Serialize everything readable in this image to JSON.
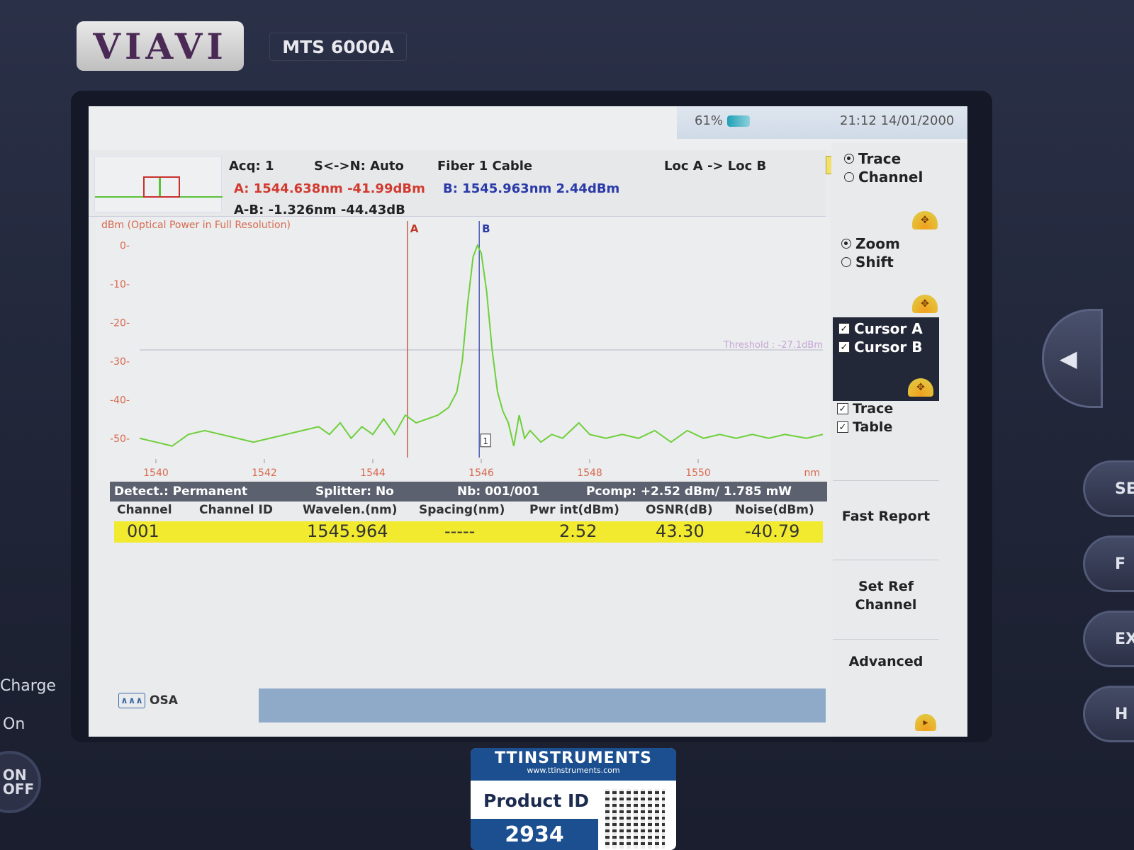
{
  "device": {
    "brand": "VIAVI",
    "model": "MTS 6000A"
  },
  "status": {
    "battery": "61%",
    "time": "21:12",
    "date": "14/01/2000"
  },
  "info": {
    "acq": "Acq: 1",
    "sn": "S<->N: Auto",
    "fiber": "Fiber  1  Cable",
    "loc": "Loc A -> Loc B",
    "cursor_a": "A: 1544.638nm -41.99dBm",
    "cursor_b": "B: 1545.963nm  2.44dBm",
    "delta": "A-B: -1.326nm -44.43dB",
    "trace_number": "1"
  },
  "right_panel": {
    "mode1_trace": "Trace",
    "mode1_channel": "Channel",
    "mode2_zoom": "Zoom",
    "mode2_shift": "Shift",
    "cursor_a": "Cursor A",
    "cursor_b": "Cursor B",
    "show_trace": "Trace",
    "show_table": "Table",
    "fast_report": "Fast Report",
    "set_ref_channel": "Set Ref Channel",
    "advanced": "Advanced"
  },
  "chart_data": {
    "type": "line",
    "ylabel": "dBm  (Optical Power in Full Resolution)",
    "xlabel": "nm",
    "xlim": [
      1539.7,
      1552.3
    ],
    "ylim": [
      -55,
      3
    ],
    "x_ticks": [
      1540,
      1542,
      1544,
      1546,
      1548,
      1550
    ],
    "y_ticks": [
      0,
      -10,
      -20,
      -30,
      -40,
      -50
    ],
    "threshold": {
      "label": "Threshold : -27.1dBm",
      "value": -27.1
    },
    "markers": [
      {
        "label": "A",
        "x": 1544.638,
        "color": "#c0392b"
      },
      {
        "label": "B",
        "x": 1545.963,
        "color": "#2a3aa8"
      }
    ],
    "channel_marker": "1",
    "series": [
      {
        "color": "#6fcf3a",
        "points": [
          [
            1539.7,
            -50
          ],
          [
            1540.0,
            -51
          ],
          [
            1540.3,
            -52
          ],
          [
            1540.6,
            -49
          ],
          [
            1540.9,
            -48
          ],
          [
            1541.2,
            -49
          ],
          [
            1541.5,
            -50
          ],
          [
            1541.8,
            -51
          ],
          [
            1542.1,
            -50
          ],
          [
            1542.4,
            -49
          ],
          [
            1542.7,
            -48
          ],
          [
            1543.0,
            -47
          ],
          [
            1543.2,
            -49
          ],
          [
            1543.4,
            -46
          ],
          [
            1543.6,
            -50
          ],
          [
            1543.8,
            -47
          ],
          [
            1544.0,
            -49
          ],
          [
            1544.2,
            -45
          ],
          [
            1544.4,
            -49
          ],
          [
            1544.6,
            -44
          ],
          [
            1544.8,
            -46
          ],
          [
            1545.0,
            -45
          ],
          [
            1545.2,
            -44
          ],
          [
            1545.4,
            -42
          ],
          [
            1545.55,
            -38
          ],
          [
            1545.65,
            -30
          ],
          [
            1545.75,
            -15
          ],
          [
            1545.85,
            -3
          ],
          [
            1545.93,
            0
          ],
          [
            1546.0,
            -2
          ],
          [
            1546.1,
            -12
          ],
          [
            1546.2,
            -27
          ],
          [
            1546.3,
            -38
          ],
          [
            1546.4,
            -43
          ],
          [
            1546.5,
            -46
          ],
          [
            1546.6,
            -52
          ],
          [
            1546.7,
            -44
          ],
          [
            1546.8,
            -50
          ],
          [
            1546.9,
            -48
          ],
          [
            1547.1,
            -51
          ],
          [
            1547.3,
            -49
          ],
          [
            1547.5,
            -50
          ],
          [
            1547.8,
            -46
          ],
          [
            1548.0,
            -49
          ],
          [
            1548.3,
            -50
          ],
          [
            1548.6,
            -49
          ],
          [
            1548.9,
            -50
          ],
          [
            1549.2,
            -48
          ],
          [
            1549.5,
            -51
          ],
          [
            1549.8,
            -48
          ],
          [
            1550.1,
            -50
          ],
          [
            1550.4,
            -49
          ],
          [
            1550.7,
            -50
          ],
          [
            1551.0,
            -49
          ],
          [
            1551.3,
            -50
          ],
          [
            1551.6,
            -49
          ],
          [
            1552.0,
            -50
          ],
          [
            1552.3,
            -49
          ]
        ]
      }
    ]
  },
  "summary": {
    "detect": "Detect.: Permanent",
    "splitter": "Splitter: No",
    "nb": "Nb: 001/001",
    "pcomp": "Pcomp:  +2.52 dBm/ 1.785 mW"
  },
  "table": {
    "headers": [
      "Channel",
      "Channel ID",
      "Wavelen.(nm)",
      "Spacing(nm)",
      "Pwr int(dBm)",
      "OSNR(dB)",
      "Noise(dBm)"
    ],
    "rows": [
      {
        "channel": "001",
        "channel_id": "",
        "wavelength": "1545.964",
        "spacing": "-----",
        "pwr": "2.52",
        "osnr": "43.30",
        "noise": "-40.79"
      }
    ]
  },
  "bottom": {
    "app": "OSA"
  },
  "bezel_labels": {
    "charge": "Charge",
    "on": "On",
    "power": "ON\nOFF",
    "btn1": "SE",
    "btn2": "F",
    "btn3": "EXI",
    "btn4": "H"
  },
  "sticker": {
    "brand": "TTINSTRUMENTS",
    "url": "www.ttinstruments.com",
    "label": "Product ID",
    "id": "2934"
  }
}
